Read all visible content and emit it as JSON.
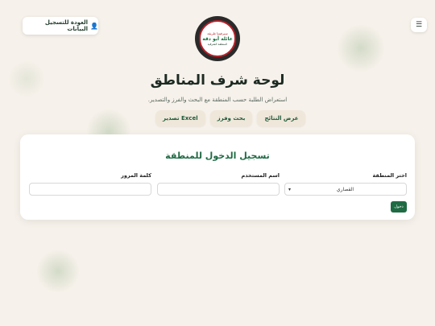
{
  "header": {
    "menu_icon": "menu-icon",
    "back_button": {
      "label": "العودة للتسجيل البيانات",
      "icon": "user-check-icon"
    },
    "logo": {
      "line1": "سيرفيتنا طريقة",
      "line2": "عائلة أبو دقة",
      "line3": "المنطقة الشرقية"
    }
  },
  "page": {
    "title": "لوحة شرف المناطق",
    "subtitle": "استعراض الطلبة حسب المنطقة مع البحث والفرز والتصدير."
  },
  "nav": {
    "results": "عرض النتائج",
    "search": "بحث وفرز",
    "export": "تصدير Excel"
  },
  "login": {
    "title": "تسجيل الدخول للمنطقة",
    "area_label": "اختر المنطقة",
    "area_value": "القصاري",
    "username_label": "اسم المستخدم",
    "username_value": "",
    "password_label": "كلمة المرور",
    "password_value": "",
    "submit": "دخول"
  },
  "colors": {
    "brand_green": "#1f6b44",
    "background": "#f6f1ea",
    "pill_bg": "#efe7da"
  }
}
